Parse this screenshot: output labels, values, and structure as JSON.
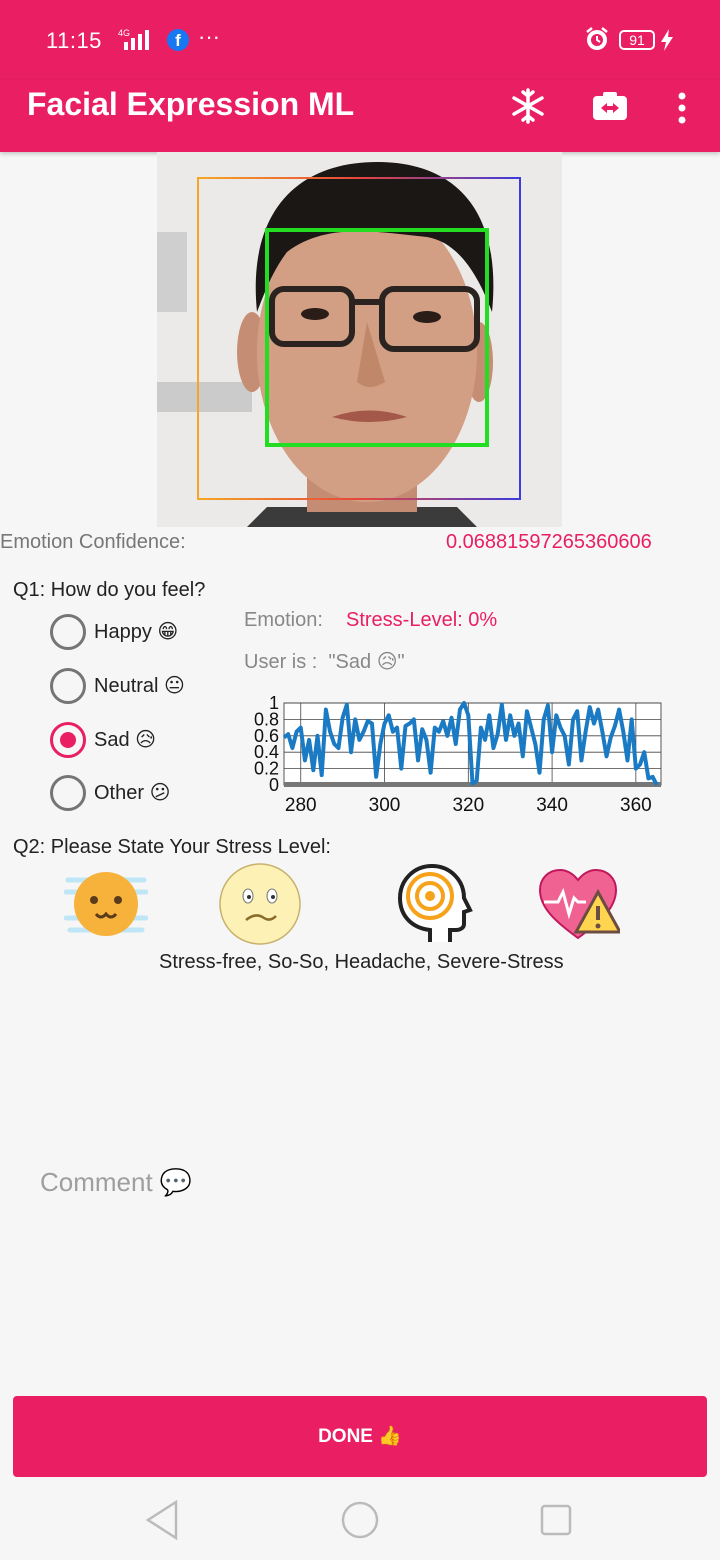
{
  "status_bar": {
    "time": "11:15",
    "network": "4G",
    "facebook_icon": "facebook-icon",
    "more": "···",
    "alarm_icon": "alarm-icon",
    "battery": "91",
    "charging_icon": "bolt-icon"
  },
  "appbar": {
    "title": "Facial Expression ML",
    "icons": [
      "snowflake-icon",
      "switch-camera-icon",
      "overflow-menu-icon"
    ]
  },
  "colors": {
    "primary": "#e91e63",
    "face_box": "#22dd22",
    "chart_line": "#1a7bc4"
  },
  "emotion_confidence": {
    "label": "Emotion Confidence:",
    "value": "0.06881597265360606"
  },
  "q1": {
    "label": "Q1: How do you feel?",
    "options": [
      {
        "label": "Happy 😁",
        "checked": false
      },
      {
        "label": "Neutral 😐",
        "checked": false
      },
      {
        "label": "Sad 😥",
        "checked": true
      },
      {
        "label": "Other 😕",
        "checked": false
      }
    ]
  },
  "emotion": {
    "label": "Emotion:",
    "stress_level": "Stress-Level: 0%",
    "user_is": "User is :  \"Sad 😥\""
  },
  "chart_data": {
    "type": "line",
    "x": [
      276,
      277,
      278,
      279,
      280,
      281,
      282,
      283,
      284,
      285,
      286,
      287,
      288,
      289,
      290,
      291,
      292,
      293,
      294,
      295,
      296,
      297,
      298,
      299,
      300,
      301,
      302,
      303,
      304,
      305,
      306,
      307,
      308,
      309,
      310,
      311,
      312,
      313,
      314,
      315,
      316,
      317,
      318,
      319,
      320,
      321,
      322,
      323,
      324,
      325,
      326,
      327,
      328,
      329,
      330,
      331,
      332,
      333,
      334,
      335,
      336,
      337,
      338,
      339,
      340,
      341,
      342,
      343,
      344,
      345,
      346,
      347,
      348,
      349,
      350,
      351,
      352,
      353,
      354,
      355,
      356,
      357,
      358,
      359,
      360,
      361,
      362,
      363,
      364,
      365
    ],
    "series": [
      {
        "values": [
          0.58,
          0.62,
          0.45,
          0.65,
          0.7,
          0.3,
          0.55,
          0.18,
          0.6,
          0.12,
          0.92,
          0.65,
          0.5,
          0.45,
          0.82,
          0.98,
          0.4,
          0.8,
          0.55,
          0.65,
          0.78,
          0.75,
          0.1,
          0.5,
          0.75,
          0.85,
          0.65,
          0.7,
          0.2,
          0.72,
          0.75,
          0.8,
          0.3,
          0.68,
          0.55,
          0.15,
          0.7,
          0.65,
          0.78,
          0.6,
          0.82,
          0.5,
          0.92,
          1.0,
          0.85,
          0.02,
          0.05,
          0.7,
          0.55,
          0.85,
          0.45,
          0.62,
          0.98,
          0.55,
          0.85,
          0.6,
          0.75,
          0.35,
          0.9,
          0.7,
          0.5,
          0.15,
          0.8,
          0.97,
          0.4,
          0.85,
          0.7,
          0.6,
          0.25,
          0.8,
          0.9,
          0.3,
          0.65,
          0.95,
          0.75,
          0.92,
          0.65,
          0.35,
          0.58,
          0.72,
          0.92,
          0.65,
          0.3,
          0.8,
          0.2,
          0.25,
          0.4,
          0.08,
          0.1,
          0.0,
          0.05,
          0.3,
          0.45,
          0.4,
          0.3,
          0.65
        ]
      }
    ],
    "xticks": [
      "280",
      "300",
      "320",
      "340",
      "360"
    ],
    "yticks": [
      "0",
      "0.2",
      "0.4",
      "0.6",
      "0.8",
      "1"
    ],
    "xlim": [
      276,
      366
    ],
    "ylim": [
      0,
      1
    ],
    "grid": true
  },
  "q2": {
    "label": "Q2: Please State Your Stress Level:",
    "icons": [
      "stress-free-icon",
      "so-so-icon",
      "headache-icon",
      "severe-stress-icon"
    ],
    "caption": "Stress-free, So-So, Headache, Severe-Stress"
  },
  "comment": {
    "placeholder": "Comment 💬"
  },
  "done_button": {
    "label": "DONE 👍"
  },
  "nav": [
    "back-icon",
    "home-icon",
    "recents-icon"
  ]
}
